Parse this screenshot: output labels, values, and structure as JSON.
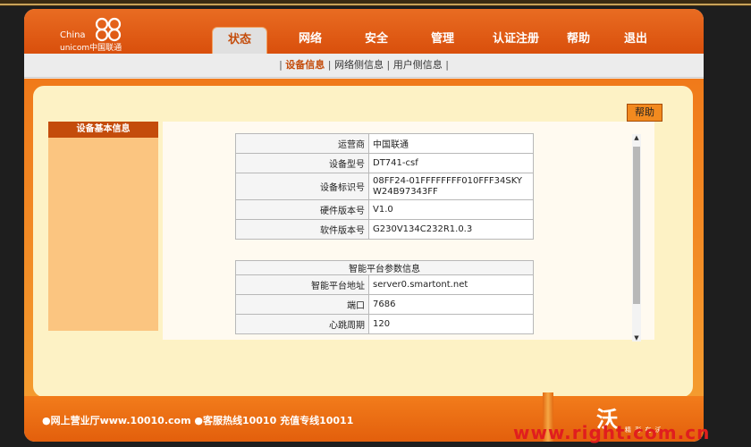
{
  "brand": {
    "line1": "China",
    "line2": "unicom中国联通"
  },
  "nav": {
    "tabs": [
      {
        "label": "状态",
        "active": true
      },
      {
        "label": "网络",
        "active": false
      },
      {
        "label": "安全",
        "active": false
      },
      {
        "label": "管理",
        "active": false
      },
      {
        "label": "认证注册",
        "active": false
      },
      {
        "label": "帮助",
        "active": false
      },
      {
        "label": "退出",
        "active": false
      }
    ]
  },
  "subnav": {
    "items": [
      {
        "label": "设备信息",
        "active": true
      },
      {
        "label": "网络侧信息",
        "active": false
      },
      {
        "label": "用户侧信息",
        "active": false
      }
    ]
  },
  "help_button": "帮助",
  "sidebar": {
    "title": "设备基本信息"
  },
  "device_info": {
    "rows": [
      {
        "key": "运营商",
        "value": "中国联通"
      },
      {
        "key": "设备型号",
        "value": "DT741-csf"
      },
      {
        "key": "设备标识号",
        "value": "08FF24-01FFFFFFFF010FFF34SKYW24B97343FF"
      },
      {
        "key": "硬件版本号",
        "value": "V1.0"
      },
      {
        "key": "软件版本号",
        "value": "G230V134C232R1.0.3"
      }
    ]
  },
  "platform_info": {
    "caption": "智能平台参数信息",
    "rows": [
      {
        "key": "智能平台地址",
        "value": "server0.smartont.net"
      },
      {
        "key": "端口",
        "value": "7686"
      },
      {
        "key": "心跳周期",
        "value": "120"
      }
    ]
  },
  "footer": {
    "text": "●网上营业厅www.10010.com ●客服热线10010 充值专线10011",
    "wo_logo": "沃",
    "wo_slogan": "精 彩 在 沃"
  },
  "watermark": "www.right.com.cn",
  "colors": {
    "brand_orange": "#e8641a",
    "active_red": "#c44c0b",
    "sidebar_bg": "#fbc580"
  }
}
